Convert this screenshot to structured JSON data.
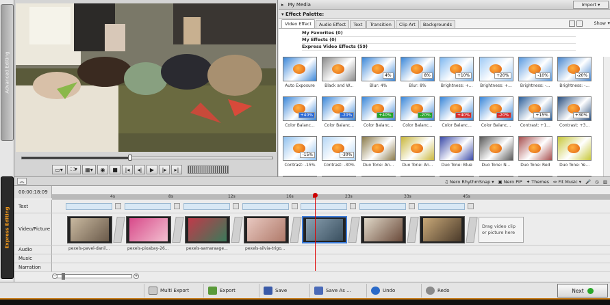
{
  "side_tabs": {
    "advanced": "Advanced Editing",
    "express": "Express Editing"
  },
  "my_media": {
    "label": "My Media",
    "import": "Import"
  },
  "effect_palette": {
    "header": "Effect Palette:",
    "tabs": [
      "Video Effect",
      "Audio Effect",
      "Text",
      "Transition",
      "Clip Art",
      "Backgrounds"
    ],
    "active_tab": "Video Effect",
    "show_label": "Show",
    "groups": [
      "My Favorites (0)",
      "My Effects (0)",
      "Express Video Effects (59)"
    ],
    "effects": [
      {
        "label": "Auto Exposure",
        "badge": "",
        "tint": "#3a86d8"
      },
      {
        "label": "Black and W...",
        "badge": "",
        "tint": "#8a8a8a"
      },
      {
        "label": "Blur: 4%",
        "badge": "4%",
        "tint": "#3a86d8"
      },
      {
        "label": "Blur: 8%",
        "badge": "8%",
        "tint": "#3a86d8"
      },
      {
        "label": "Brightness: +...",
        "badge": "+10%",
        "tint": "#7fb8f0"
      },
      {
        "label": "Brightness: +...",
        "badge": "+20%",
        "tint": "#9fcaf5"
      },
      {
        "label": "Brightness: -...",
        "badge": "-10%",
        "tint": "#5a9ae0"
      },
      {
        "label": "Brightness: -...",
        "badge": "-20%",
        "tint": "#4a88d0"
      },
      {
        "label": "Color Balanc...",
        "badge": "+40%",
        "tint": "#3a86d8",
        "badge_color": "#2a6ad8"
      },
      {
        "label": "Color Balanc...",
        "badge": "-20%",
        "tint": "#3a86d8",
        "badge_color": "#2a6ad8"
      },
      {
        "label": "Color Balanc...",
        "badge": "+40%",
        "tint": "#3a86d8",
        "badge_color": "#22a52a"
      },
      {
        "label": "Color Balanc...",
        "badge": "-20%",
        "tint": "#3a86d8",
        "badge_color": "#22a52a"
      },
      {
        "label": "Color Balanc...",
        "badge": "+40%",
        "tint": "#3a86d8",
        "badge_color": "#d82a2a"
      },
      {
        "label": "Color Balanc...",
        "badge": "-20%",
        "tint": "#3a86d8",
        "badge_color": "#d82a2a"
      },
      {
        "label": "Contrast: +1...",
        "badge": "+15%",
        "tint": "#2c5f9a"
      },
      {
        "label": "Contrast: +3...",
        "badge": "+30%",
        "tint": "#2a5080"
      },
      {
        "label": "Contrast: -15%",
        "badge": "-15%",
        "tint": "#8ec0ee"
      },
      {
        "label": "Contrast: -30%",
        "badge": "-30%",
        "tint": "#b4d6f5"
      },
      {
        "label": "Duo Tone: An...",
        "badge": "",
        "tint": "#8a7a4a"
      },
      {
        "label": "Duo Tone: An...",
        "badge": "",
        "tint": "#c8b63a"
      },
      {
        "label": "Duo Tone: Blue",
        "badge": "",
        "tint": "#3a4aa8"
      },
      {
        "label": "Duo Tone: N...",
        "badge": "",
        "tint": "#5a5a5a"
      },
      {
        "label": "Duo Tone: Red",
        "badge": "",
        "tint": "#a85050"
      },
      {
        "label": "Duo Tone: Ye...",
        "badge": "",
        "tint": "#c8c83a"
      },
      {
        "label": "",
        "badge": "",
        "tint": "#4a90e0"
      },
      {
        "label": "",
        "badge": "",
        "tint": "#d0d0d0"
      },
      {
        "label": "",
        "badge": "",
        "tint": "#4a90e0"
      },
      {
        "label": "",
        "badge": "",
        "tint": "#3a86d8"
      },
      {
        "label": "",
        "badge": "",
        "tint": "#3a86d8"
      },
      {
        "label": "",
        "badge": "",
        "tint": "#3a86d8"
      },
      {
        "label": "",
        "badge": "",
        "tint": "#3a86d8"
      },
      {
        "label": "",
        "badge": "",
        "tint": "#3a86d8"
      }
    ]
  },
  "midbar": {
    "rhythm": "Nero RhythmSnap",
    "pip": "Nero PiP",
    "themes": "Themes",
    "fit": "Fit Music"
  },
  "timeline": {
    "timecode": "00:00:18:09",
    "ticks": [
      "4s",
      "8s",
      "12s",
      "16s",
      "23s",
      "33s",
      "45s"
    ],
    "tracks": [
      "Text",
      "Video/Picture",
      "Audio",
      "Music",
      "Narration"
    ],
    "clips": [
      {
        "label": "pexels-pavel-danil...",
        "c1": "#c9b9a0",
        "c2": "#6a5a4a"
      },
      {
        "label": "pexels-pixabay-26...",
        "c1": "#d84a8a",
        "c2": "#f2c0d0"
      },
      {
        "label": "pexels-samaraage...",
        "c1": "#c03a4a",
        "c2": "#3a7a5a"
      },
      {
        "label": "pexels-silvia-trigo...",
        "c1": "#e8c8c0",
        "c2": "#b07a6a"
      },
      {
        "label": "",
        "c1": "#8aa0b0",
        "c2": "#3a5060"
      },
      {
        "label": "",
        "c1": "#e0d8c8",
        "c2": "#6a4a3a"
      },
      {
        "label": "",
        "c1": "#c8a878",
        "c2": "#4a3a2a"
      }
    ],
    "drag_hint": "Drag video clip or picture here"
  },
  "bottom": {
    "multi_export": "Multi Export",
    "export": "Export",
    "save": "Save",
    "save_as": "Save As ...",
    "undo": "Undo",
    "redo": "Redo",
    "next": "Next"
  },
  "colors": {
    "accent": "#f39a1c",
    "playhead": "#e10000"
  }
}
